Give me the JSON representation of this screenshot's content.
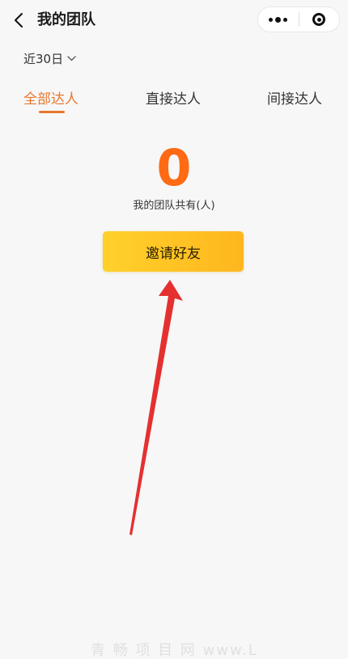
{
  "nav": {
    "title": "我的团队"
  },
  "filter": {
    "date_range": "近30日"
  },
  "tabs": [
    {
      "label": "全部达人",
      "active": true
    },
    {
      "label": "直接达人",
      "active": false
    },
    {
      "label": "间接达人",
      "active": false
    }
  ],
  "team": {
    "count": "0",
    "count_label": "我的团队共有(人)"
  },
  "actions": {
    "invite_label": "邀请好友"
  },
  "watermark": "青 畅 项 目 网  www.L",
  "colors": {
    "accent": "#e8772e",
    "count": "#ff6a13",
    "button_start": "#ffd12b",
    "button_end": "#ffb61e",
    "annotation_arrow": "#e53030"
  }
}
